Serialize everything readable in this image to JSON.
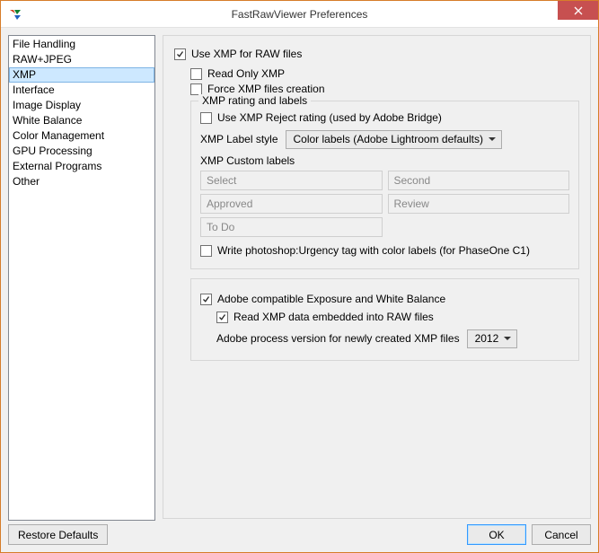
{
  "window": {
    "title": "FastRawViewer Preferences"
  },
  "sidebar": {
    "items": [
      {
        "label": "File Handling"
      },
      {
        "label": "RAW+JPEG"
      },
      {
        "label": "XMP"
      },
      {
        "label": "Interface"
      },
      {
        "label": "Image Display"
      },
      {
        "label": "White Balance"
      },
      {
        "label": "Color Management"
      },
      {
        "label": "GPU Processing"
      },
      {
        "label": "External Programs"
      },
      {
        "label": "Other"
      }
    ],
    "selected_index": 2
  },
  "settings": {
    "use_xmp_raw": "Use XMP for RAW files",
    "read_only_xmp": "Read Only XMP",
    "force_xmp_creation": "Force XMP files creation",
    "group1": {
      "legend": "XMP rating and labels",
      "use_reject": "Use XMP Reject rating (used by Adobe Bridge)",
      "label_style_label": "XMP Label style",
      "label_style_value": "Color labels (Adobe Lightroom defaults)",
      "custom_labels_title": "XMP Custom labels",
      "custom_labels": [
        "Select",
        "Second",
        "Approved",
        "Review",
        "To Do"
      ],
      "urgency": "Write photoshop:Urgency tag with color labels (for PhaseOne C1)"
    },
    "group2": {
      "adobe_compat": "Adobe compatible Exposure and White Balance",
      "read_embedded": "Read XMP data embedded into RAW files",
      "process_version_label": "Adobe process version for newly created XMP files",
      "process_version_value": "2012"
    }
  },
  "buttons": {
    "restore": "Restore Defaults",
    "ok": "OK",
    "cancel": "Cancel"
  }
}
